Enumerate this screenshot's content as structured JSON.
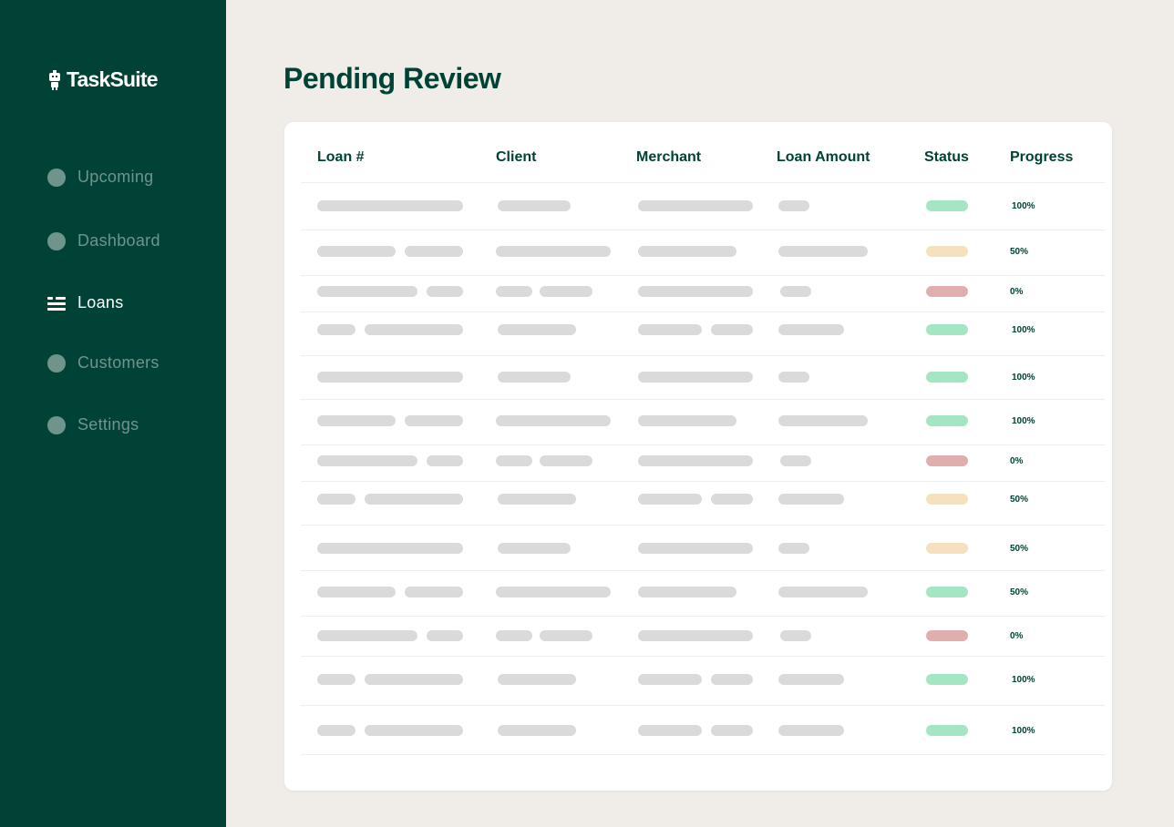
{
  "app": {
    "name": "TaskSuite"
  },
  "nav": [
    {
      "label": "Upcoming",
      "icon": "circle-icon",
      "active": false
    },
    {
      "label": "Dashboard",
      "icon": "circle-icon",
      "active": false
    },
    {
      "label": "Loans",
      "icon": "list-icon",
      "active": true
    },
    {
      "label": "Customers",
      "icon": "circle-icon",
      "active": false
    },
    {
      "label": "Settings",
      "icon": "circle-icon",
      "active": false
    }
  ],
  "page": {
    "title": "Pending Review"
  },
  "table": {
    "headers": [
      "Loan #",
      "Client",
      "Merchant",
      "Loan Amount",
      "Status",
      "Progress"
    ],
    "rows": [
      {
        "status": "success",
        "progress": "100%"
      },
      {
        "status": "warning",
        "progress": "50%"
      },
      {
        "status": "error",
        "progress": "0%"
      },
      {
        "status": "success",
        "progress": "100%"
      },
      {
        "status": "success",
        "progress": "100%"
      },
      {
        "status": "success",
        "progress": "100%"
      },
      {
        "status": "error",
        "progress": "0%"
      },
      {
        "status": "warning",
        "progress": "50%"
      },
      {
        "status": "warning",
        "progress": "50%"
      },
      {
        "status": "success",
        "progress": "50%"
      },
      {
        "status": "error",
        "progress": "0%"
      },
      {
        "status": "success",
        "progress": "100%"
      },
      {
        "status": "success",
        "progress": "100%"
      }
    ]
  },
  "colors": {
    "sidebar": "#004336",
    "background": "#f0ece8",
    "accent": "#004336",
    "nav_inactive": "#6f948b",
    "skeleton": "#dadada",
    "status_success": "#a4e5c3",
    "status_warning": "#f5e1bd",
    "status_error": "#e1aeae"
  }
}
